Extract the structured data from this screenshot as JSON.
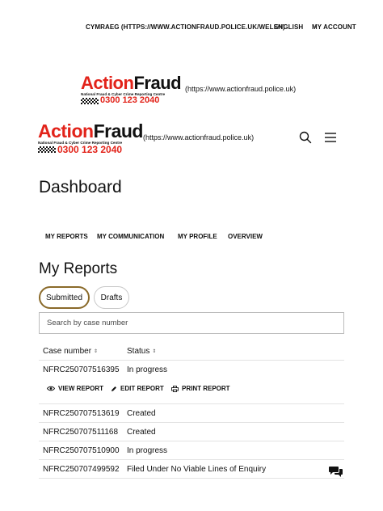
{
  "topnav": {
    "welsh_link": "CYMRAEG (HTTPS://WWW.ACTIONFRAUD.POLICE.UK/WELSH)",
    "language": "ENGLISH",
    "account": "MY ACCOUNT"
  },
  "logo": {
    "word_action": "Action",
    "word_fraud": "Fraud",
    "tagline": "National Fraud & Cyber Crime Reporting Centre",
    "phone": "0300 123 2040",
    "url_text": "(https://www.actionfraud.police.uk)"
  },
  "page_title": "Dashboard",
  "tabs": [
    "MY REPORTS",
    "MY COMMUNICATION",
    "MY PROFILE",
    "OVERVIEW"
  ],
  "section_title": "My Reports",
  "filters": {
    "submitted": "Submitted",
    "drafts": "Drafts"
  },
  "search": {
    "placeholder": "Search by case number"
  },
  "table": {
    "headers": {
      "case_number": "Case number",
      "status": "Status"
    },
    "rows": [
      {
        "case": "NFRC250707516395",
        "status": "In progress"
      },
      {
        "case": "NFRC250707513619",
        "status": "Created"
      },
      {
        "case": "NFRC250707511168",
        "status": "Created"
      },
      {
        "case": "NFRC250707510900",
        "status": "In progress"
      },
      {
        "case": "NFRC250707499592",
        "status": "Filed Under No Viable Lines of Enquiry"
      }
    ],
    "actions": {
      "view": "VIEW REPORT",
      "edit": "EDIT REPORT",
      "print": "PRINT REPORT"
    }
  },
  "colors": {
    "brand_red": "#e2231a",
    "active_pill_border": "#8a6a2a"
  },
  "icons": [
    "chevron-down-icon",
    "search-icon",
    "menu-icon",
    "eye-icon",
    "pencil-icon",
    "printer-icon",
    "chat-icon"
  ]
}
